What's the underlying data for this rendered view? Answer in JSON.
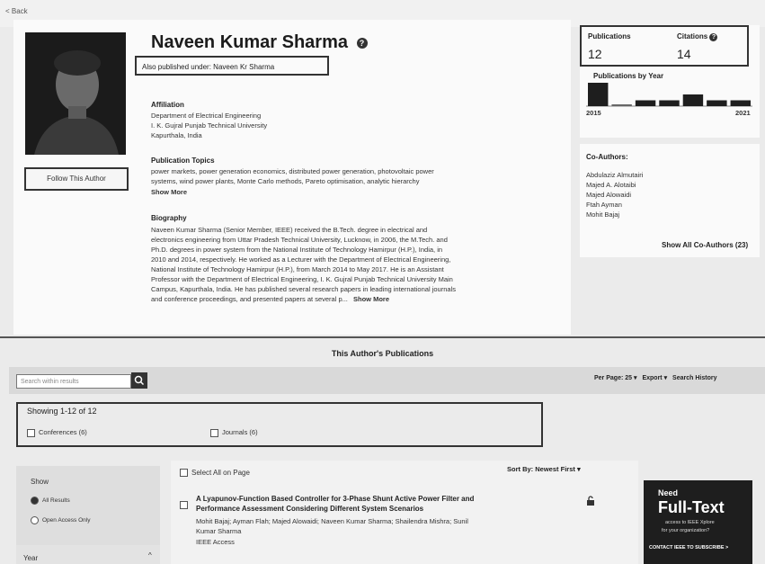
{
  "back_link": "< Back",
  "author": {
    "name": "Naveen Kumar Sharma",
    "also_published": "Also published under: Naveen Kr Sharma",
    "follow_label": "Follow This Author",
    "affiliation_heading": "Affiliation",
    "affiliation": [
      "Department of Electrical Engineering",
      "I. K. Gujral Punjab Technical University",
      "Kapurthala, India"
    ],
    "topics_heading": "Publication Topics",
    "topics_line1": "power markets, power generation economics, distributed power generation, photovoltaic power",
    "topics_line2": "systems, wind power plants, Monte Carlo methods, Pareto optimisation, analytic hierarchy",
    "topics_more": "Show More",
    "bio_heading": "Biography",
    "bio_lines": [
      "Naveen Kumar Sharma (Senior Member, IEEE) received the B.Tech. degree in electrical and",
      "electronics engineering from Uttar Pradesh Technical University, Lucknow, in 2006, the M.Tech. and",
      "Ph.D. degrees in power system from the National Institute of Technology Hamirpur (H.P.), India, in",
      "2010 and 2014, respectively. He worked as a Lecturer with the Department of Electrical Engineering,",
      "National Institute of Technology Hamirpur (H.P.), from March 2014 to May 2017. He is an Assistant",
      "Professor with the Department of Electrical Engineering, I. K. Gujral Punjab Technical University Main",
      "Campus, Kapurthala, India. He has published several research papers in leading international journals",
      "and conference proceedings, and presented papers at several p..."
    ],
    "bio_more": "Show More"
  },
  "stats": {
    "publications_label": "Publications",
    "publications_value": "12",
    "citations_label": "Citations",
    "citations_value": "14",
    "by_year_label": "Publications by Year",
    "year_start": "2015",
    "year_end": "2021"
  },
  "chart_data": {
    "type": "bar",
    "title": "Publications by Year",
    "categories": [
      "2015",
      "2016",
      "2017",
      "2018",
      "2019",
      "2020",
      "2021"
    ],
    "values": [
      4,
      0,
      1,
      1,
      2,
      1,
      1
    ],
    "xlabel": "",
    "ylabel": ""
  },
  "coauthors": {
    "heading": "Co-Authors:",
    "names": [
      "Abdulaziz Almutairi",
      "Majed A. Alotaibi",
      "Majed Alowaidi",
      "Ftah Ayman",
      "Mohit Bajaj"
    ],
    "show_all": "Show All Co-Authors (23)"
  },
  "publications": {
    "heading": "This Author's Publications",
    "search_placeholder": "Search within results",
    "per_page": "Per Page: 25",
    "export": "Export",
    "search_history": "Search History",
    "showing": "Showing 1-12 of 12",
    "filter_conferences": "Conferences (6)",
    "filter_journals": "Journals (6)",
    "select_all": "Select All on Page",
    "sort_by_label": "Sort By:",
    "sort_by_value": "Newest First",
    "show_heading": "Show",
    "show_all_results": "All Results",
    "show_open_access": "Open Access Only",
    "year_heading": "Year",
    "result1_title_1": "A Lyapunov-Function Based Controller for 3-Phase Shunt Active Power Filter and",
    "result1_title_2": "Performance Assessment Considering Different System Scenarios",
    "result1_authors_1": "Mohit Bajaj; Ayman Flah; Majed Alowaidi; Naveen Kumar Sharma; Shailendra Mishra; Sunil",
    "result1_authors_2": "Kumar Sharma",
    "result1_venue": "IEEE Access"
  },
  "ad": {
    "need": "Need",
    "full_text": "Full-Text",
    "line1": "access to IEEE Xplore",
    "line2": "for your organization?",
    "cta": "CONTACT IEEE TO SUBSCRIBE >"
  }
}
